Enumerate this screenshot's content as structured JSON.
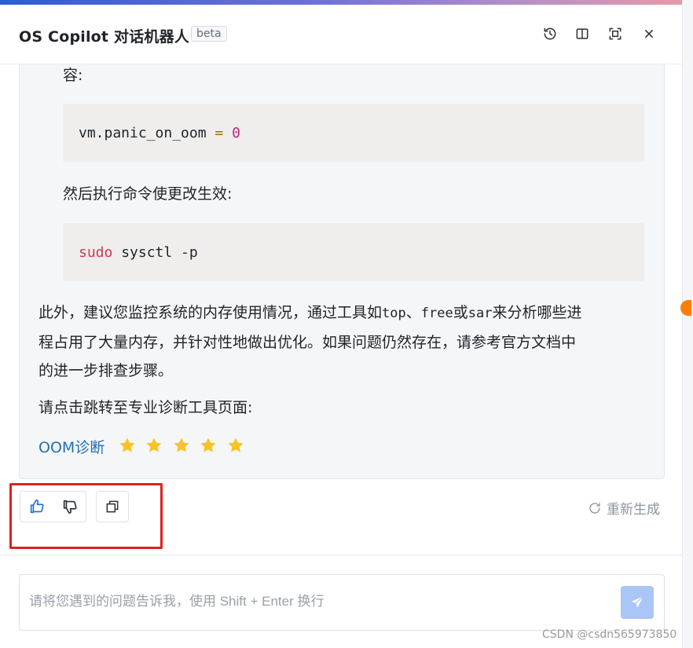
{
  "header": {
    "title": "OS Copilot 对话机器人",
    "badge": "beta"
  },
  "answer": {
    "line_partial": "容:",
    "code1": {
      "name": "vm.panic_on_oom",
      "op": "=",
      "value": "0"
    },
    "line_then": "然后执行命令使更改生效:",
    "code2": {
      "cmd": "sudo",
      "args": "sysctl -p"
    },
    "para": {
      "l1a": "此外，建议您监控系统的内存使用情况，通过工具如",
      "tool1": "top",
      "sep1": "、",
      "tool2": "free",
      "or": "或",
      "tool3": "sar",
      "l1b": "来分析哪些进",
      "l2": "程占用了大量内存，并针对性地做出优化。如果问题仍然存在，请参考官方文档中",
      "l3": "的进一步排查步骤。"
    },
    "prompt": "请点击跳转至专业诊断工具页面:",
    "link": "OOM诊断",
    "rating": {
      "stars": 5,
      "max": 5
    }
  },
  "actions": {
    "regenerate": "重新生成"
  },
  "input": {
    "placeholder": "请将您遇到的问题告诉我，使用 Shift + Enter 换行"
  },
  "watermark": "CSDN @csdn565973850",
  "colors": {
    "accent": "#1f6fb7",
    "highlight": "#e02020",
    "send": "#a9c6f7",
    "star": "#f7c325"
  }
}
